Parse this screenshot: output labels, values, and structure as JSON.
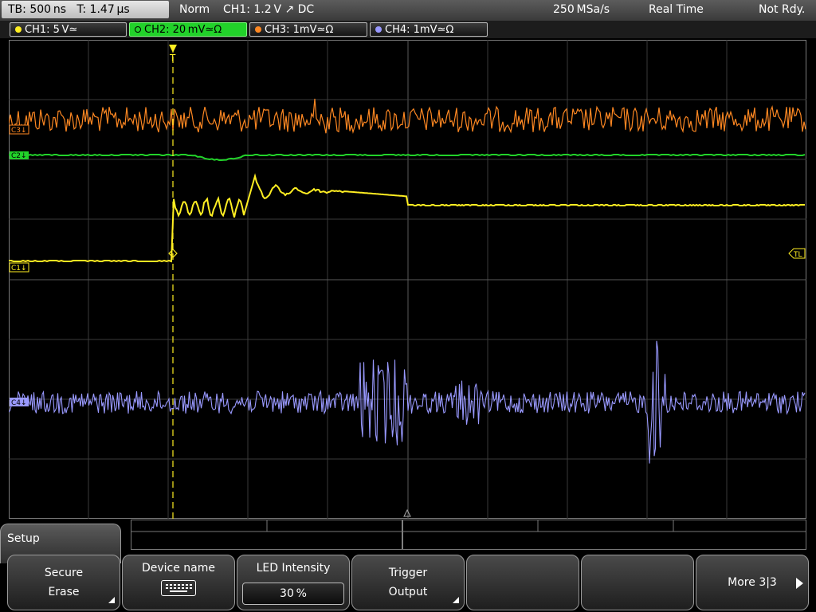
{
  "status_bar": {
    "timebase": "TB: 500 ns",
    "trigger_time": "T: 1.47 µs",
    "mode": "Norm",
    "trigger_source": "CH1: 1.2 V ↗ DC",
    "sample_rate": "250 MSa/s",
    "acquisition": "Real Time",
    "state": "Not Rdy."
  },
  "channels": [
    {
      "label": "CH1: 5 V≃",
      "color": "#ffee22",
      "active": false
    },
    {
      "label": "CH2: 20 mV≃Ω",
      "color": "#22d22a",
      "active": true
    },
    {
      "label": "CH3: 1mV≃Ω",
      "color": "#ff8822",
      "active": false
    },
    {
      "label": "CH4: 1mV≃Ω",
      "color": "#9999ff",
      "active": false
    }
  ],
  "trace_markers": {
    "ch3": "C3↓",
    "ch2": "C2↓",
    "ch1": "C1↓",
    "ch4": "C4↓",
    "trigger_level": "TL"
  },
  "colors": {
    "ch1": "#ffee22",
    "ch2": "#22d22a",
    "ch3": "#ff8822",
    "ch4": "#9999ff",
    "grid": "#7a7a7a",
    "trigger_line": "#ffee22"
  },
  "menu": {
    "title": "Setup",
    "softkeys": [
      {
        "line1": "Secure",
        "line2": "Erase"
      },
      {
        "line1": "Device name",
        "icon": "keyboard-icon"
      },
      {
        "line1": "LED Intensity",
        "value": "30 %"
      },
      {
        "line1": "Trigger",
        "line2": "Output"
      },
      {
        "line1": ""
      },
      {
        "line1": ""
      },
      {
        "line1": "More 3|3"
      }
    ]
  }
}
